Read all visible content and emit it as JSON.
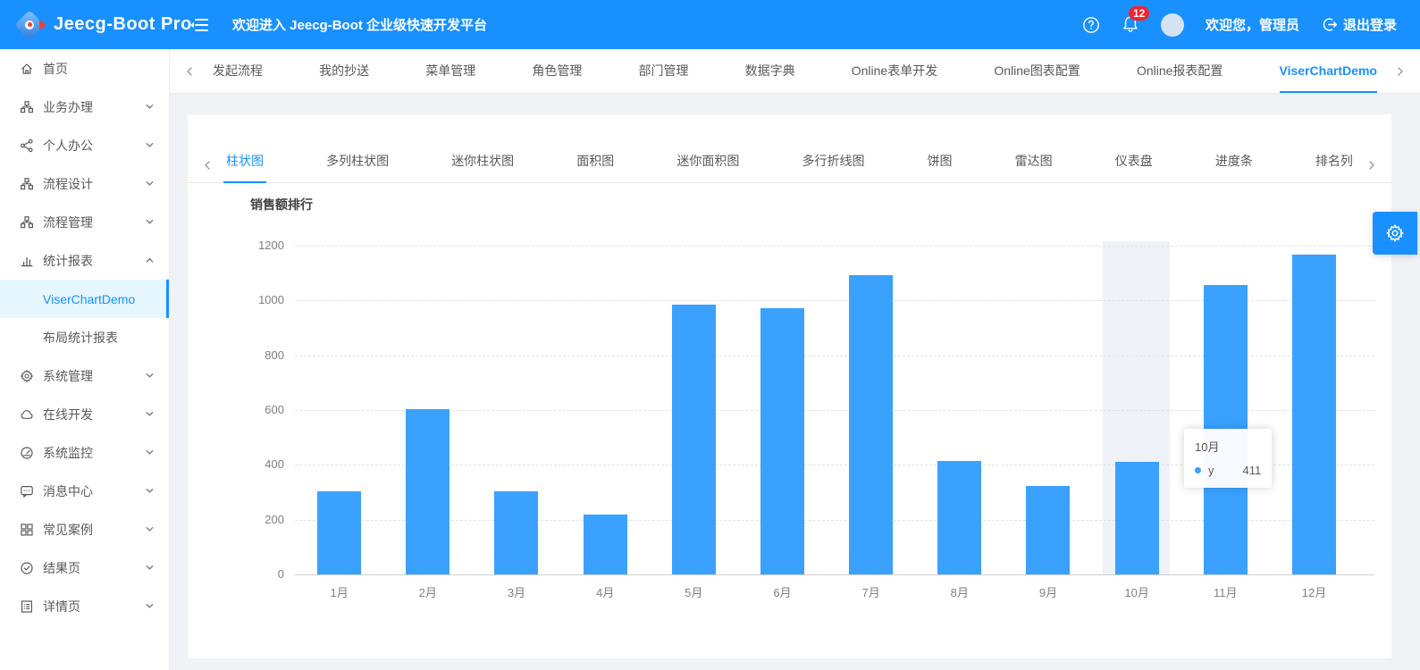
{
  "header": {
    "logo_text": "Jeecg-Boot Pro",
    "welcome": "欢迎进入 Jeecg-Boot 企业级快速开发平台",
    "badge_count": "12",
    "user_greeting": "欢迎您，管理员",
    "logout_label": "退出登录"
  },
  "sidebar": {
    "items": [
      {
        "label": "首页",
        "icon": "home-icon",
        "type": "item"
      },
      {
        "label": "业务办理",
        "icon": "apartment-icon",
        "type": "submenu"
      },
      {
        "label": "个人办公",
        "icon": "share-icon",
        "type": "submenu"
      },
      {
        "label": "流程设计",
        "icon": "apartment-icon",
        "type": "submenu"
      },
      {
        "label": "流程管理",
        "icon": "apartment-icon",
        "type": "submenu"
      },
      {
        "label": "统计报表",
        "icon": "bar-chart-icon",
        "type": "submenu",
        "expanded": true
      },
      {
        "label": "ViserChartDemo",
        "icon": "",
        "type": "child",
        "active": true
      },
      {
        "label": "布局统计报表",
        "icon": "",
        "type": "child"
      },
      {
        "label": "系统管理",
        "icon": "gear-icon",
        "type": "submenu"
      },
      {
        "label": "在线开发",
        "icon": "cloud-icon",
        "type": "submenu"
      },
      {
        "label": "系统监控",
        "icon": "dashboard-icon",
        "type": "submenu"
      },
      {
        "label": "消息中心",
        "icon": "message-icon",
        "type": "submenu"
      },
      {
        "label": "常见案例",
        "icon": "blocks-icon",
        "type": "submenu"
      },
      {
        "label": "结果页",
        "icon": "check-circle-icon",
        "type": "submenu"
      },
      {
        "label": "详情页",
        "icon": "profile-icon",
        "type": "submenu"
      }
    ]
  },
  "tab_bar": {
    "active_tab": "ViserChartDemo",
    "tabs": [
      {
        "label": "发起流程"
      },
      {
        "label": "我的抄送"
      },
      {
        "label": "菜单管理"
      },
      {
        "label": "角色管理"
      },
      {
        "label": "部门管理"
      },
      {
        "label": "数据字典"
      },
      {
        "label": "Online表单开发"
      },
      {
        "label": "Online图表配置"
      },
      {
        "label": "Online报表配置"
      },
      {
        "label": "ViserChartDemo"
      }
    ]
  },
  "chart_tabs": {
    "active_tab": "柱状图",
    "tabs": [
      {
        "label": "柱状图"
      },
      {
        "label": "多列柱状图"
      },
      {
        "label": "迷你柱状图"
      },
      {
        "label": "面积图"
      },
      {
        "label": "迷你面积图"
      },
      {
        "label": "多行折线图"
      },
      {
        "label": "饼图"
      },
      {
        "label": "雷达图"
      },
      {
        "label": "仪表盘"
      },
      {
        "label": "进度条"
      },
      {
        "label": "排名列"
      }
    ]
  },
  "chart_data": {
    "type": "bar",
    "title": "销售额排行",
    "categories": [
      "1月",
      "2月",
      "3月",
      "4月",
      "5月",
      "6月",
      "7月",
      "8月",
      "9月",
      "10月",
      "11月",
      "12月"
    ],
    "values": [
      303,
      603,
      302,
      220,
      985,
      973,
      1093,
      415,
      324,
      411,
      1055,
      1167
    ],
    "xlabel": "",
    "ylabel": "",
    "ylim": [
      0,
      1200
    ],
    "yticks": [
      0,
      200,
      400,
      600,
      800,
      1000,
      1200
    ],
    "bar_color": "#3aa1ff",
    "grid": "dashed-horizontal",
    "legend_position": "none",
    "highlighted_category": "10月",
    "tooltip": {
      "title": "10月",
      "series_name": "y",
      "value": "411"
    }
  },
  "colors": {
    "header_blue": "#1890ff",
    "bar_blue": "#3aa1ff",
    "active_tab_blue": "#1890ff",
    "badge_red": "#f5222d",
    "selected_menu_bg": "#e6f7ff",
    "page_bg": "#f0f2f5"
  }
}
